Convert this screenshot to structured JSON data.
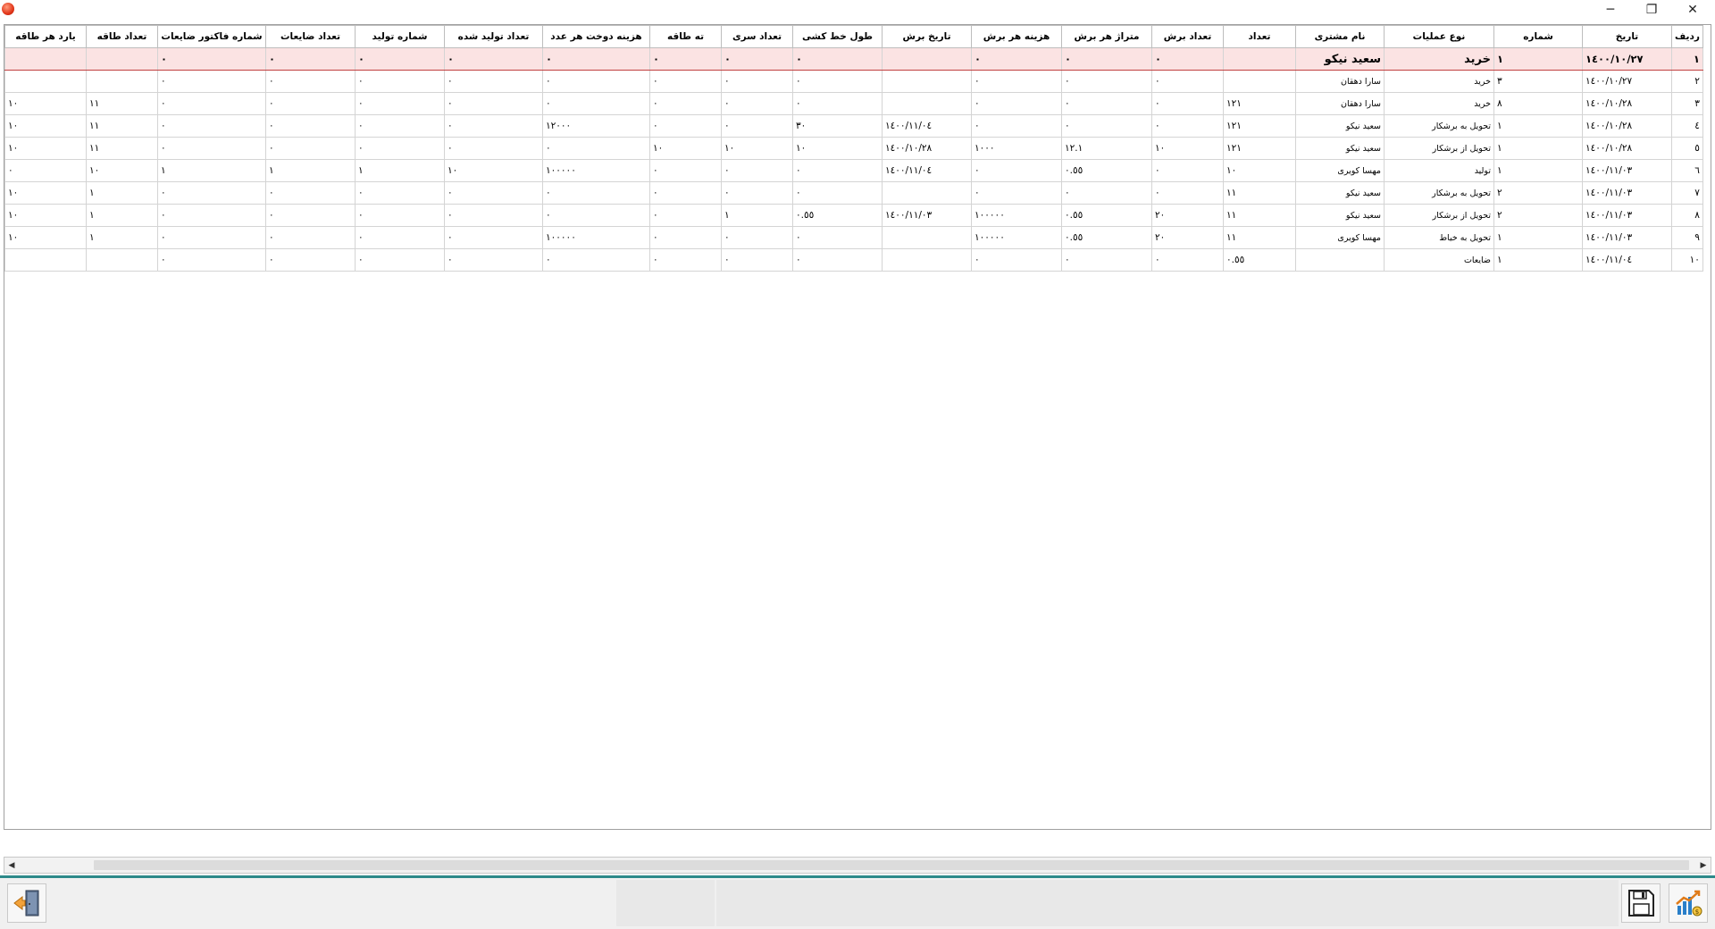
{
  "window": {
    "min": "─",
    "max": "❐",
    "close": "✕"
  },
  "columns": [
    "ردیف",
    "تاریخ",
    "شماره",
    "نوع عملیات",
    "نام مشتری",
    "تعداد",
    "تعداد برش",
    "متراژ هر برش",
    "هزینه هر برش",
    "تاریخ برش",
    "طول خط کشی",
    "تعداد سری",
    "ته طاقه",
    "هزینه دوخت هر عدد",
    "تعداد تولید شده",
    "شماره تولید",
    "تعداد ضایعات",
    "شماره فاکتور ضایعات",
    "تعداد طاقه",
    "یارد هر طاقه"
  ],
  "rows": [
    [
      "١",
      "١٤٠٠/١٠/٢٧",
      "١",
      "خرید",
      "سعید نیکو",
      "",
      "٠",
      "٠",
      "٠",
      "",
      "٠",
      "٠",
      "٠",
      "٠",
      "٠",
      "٠",
      "٠",
      "٠",
      "",
      ""
    ],
    [
      "٢",
      "١٤٠٠/١٠/٢٧",
      "٣",
      "خرید",
      "سارا دهقان",
      "",
      "٠",
      "٠",
      "٠",
      "",
      "٠",
      "٠",
      "٠",
      "٠",
      "٠",
      "٠",
      "٠",
      "٠",
      "",
      ""
    ],
    [
      "٣",
      "١٤٠٠/١٠/٢٨",
      "٨",
      "خرید",
      "سارا دهقان",
      "١٢١",
      "٠",
      "٠",
      "٠",
      "",
      "٠",
      "٠",
      "٠",
      "٠",
      "٠",
      "٠",
      "٠",
      "٠",
      "١١",
      "١٠"
    ],
    [
      "٤",
      "١٤٠٠/١٠/٢٨",
      "١",
      "تحویل به برشکار",
      "سعید نیکو",
      "١٢١",
      "٠",
      "٠",
      "٠",
      "١٤٠٠/١١/٠٤",
      "٣٠",
      "٠",
      "٠",
      "١٢٠٠٠",
      "٠",
      "٠",
      "٠",
      "٠",
      "١١",
      "١٠"
    ],
    [
      "٥",
      "١٤٠٠/١٠/٢٨",
      "١",
      "تحویل از برشکار",
      "سعید نیکو",
      "١٢١",
      "١٠",
      "١٢.١",
      "١٠٠٠",
      "١٤٠٠/١٠/٢٨",
      "١٠",
      "١٠",
      "١٠",
      "٠",
      "٠",
      "٠",
      "٠",
      "٠",
      "١١",
      "١٠"
    ],
    [
      "٦",
      "١٤٠٠/١١/٠٣",
      "١",
      "تولید",
      "مهسا کویری",
      "١٠",
      "٠",
      "٠.٥٥",
      "٠",
      "١٤٠٠/١١/٠٤",
      "٠",
      "٠",
      "٠",
      "١٠٠٠٠٠",
      "١٠",
      "١",
      "١",
      "١",
      "١٠",
      "٠"
    ],
    [
      "٧",
      "١٤٠٠/١١/٠٣",
      "٢",
      "تحویل به برشکار",
      "سعید نیکو",
      "١١",
      "٠",
      "٠",
      "٠",
      "",
      "٠",
      "٠",
      "٠",
      "٠",
      "٠",
      "٠",
      "٠",
      "٠",
      "١",
      "١٠"
    ],
    [
      "٨",
      "١٤٠٠/١١/٠٣",
      "٢",
      "تحویل از برشکار",
      "سعید نیکو",
      "١١",
      "٢٠",
      "٠.٥٥",
      "١٠٠٠٠٠",
      "١٤٠٠/١١/٠٣",
      "٠.٥٥",
      "١",
      "٠",
      "٠",
      "٠",
      "٠",
      "٠",
      "٠",
      "١",
      "١٠"
    ],
    [
      "٩",
      "١٤٠٠/١١/٠٣",
      "١",
      "تحویل به خیاط",
      "مهسا کویری",
      "١١",
      "٢٠",
      "٠.٥٥",
      "١٠٠٠٠٠",
      "",
      "٠",
      "٠",
      "٠",
      "١٠٠٠٠٠",
      "٠",
      "٠",
      "٠",
      "٠",
      "١",
      "١٠"
    ],
    [
      "١٠",
      "١٤٠٠/١١/٠٤",
      "١",
      "ضایعات",
      "",
      "٠.٥٥",
      "٠",
      "٠",
      "٠",
      "",
      "٠",
      "٠",
      "٠",
      "٠",
      "٠",
      "٠",
      "٠",
      "٠",
      "",
      ""
    ]
  ],
  "colors": {
    "selected_row": "#fbe3e3",
    "footer_accent": "#2d8a8a"
  },
  "icons": {
    "exit": "exit-door-icon",
    "save": "save-disk-icon",
    "report": "report-chart-icon"
  }
}
